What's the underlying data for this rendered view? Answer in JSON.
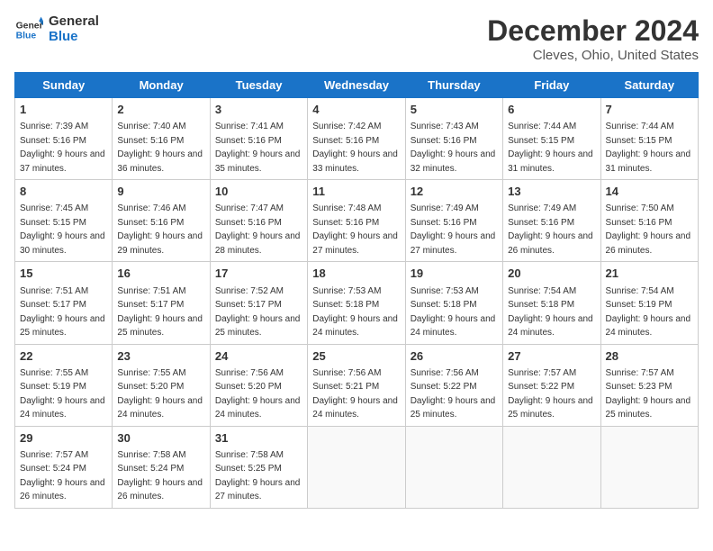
{
  "header": {
    "logo_line1": "General",
    "logo_line2": "Blue",
    "title": "December 2024",
    "subtitle": "Cleves, Ohio, United States"
  },
  "days_of_week": [
    "Sunday",
    "Monday",
    "Tuesday",
    "Wednesday",
    "Thursday",
    "Friday",
    "Saturday"
  ],
  "weeks": [
    [
      {
        "day": "1",
        "sunrise": "7:39 AM",
        "sunset": "5:16 PM",
        "daylight": "9 hours and 37 minutes."
      },
      {
        "day": "2",
        "sunrise": "7:40 AM",
        "sunset": "5:16 PM",
        "daylight": "9 hours and 36 minutes."
      },
      {
        "day": "3",
        "sunrise": "7:41 AM",
        "sunset": "5:16 PM",
        "daylight": "9 hours and 35 minutes."
      },
      {
        "day": "4",
        "sunrise": "7:42 AM",
        "sunset": "5:16 PM",
        "daylight": "9 hours and 33 minutes."
      },
      {
        "day": "5",
        "sunrise": "7:43 AM",
        "sunset": "5:16 PM",
        "daylight": "9 hours and 32 minutes."
      },
      {
        "day": "6",
        "sunrise": "7:44 AM",
        "sunset": "5:15 PM",
        "daylight": "9 hours and 31 minutes."
      },
      {
        "day": "7",
        "sunrise": "7:44 AM",
        "sunset": "5:15 PM",
        "daylight": "9 hours and 31 minutes."
      }
    ],
    [
      {
        "day": "8",
        "sunrise": "7:45 AM",
        "sunset": "5:15 PM",
        "daylight": "9 hours and 30 minutes."
      },
      {
        "day": "9",
        "sunrise": "7:46 AM",
        "sunset": "5:16 PM",
        "daylight": "9 hours and 29 minutes."
      },
      {
        "day": "10",
        "sunrise": "7:47 AM",
        "sunset": "5:16 PM",
        "daylight": "9 hours and 28 minutes."
      },
      {
        "day": "11",
        "sunrise": "7:48 AM",
        "sunset": "5:16 PM",
        "daylight": "9 hours and 27 minutes."
      },
      {
        "day": "12",
        "sunrise": "7:49 AM",
        "sunset": "5:16 PM",
        "daylight": "9 hours and 27 minutes."
      },
      {
        "day": "13",
        "sunrise": "7:49 AM",
        "sunset": "5:16 PM",
        "daylight": "9 hours and 26 minutes."
      },
      {
        "day": "14",
        "sunrise": "7:50 AM",
        "sunset": "5:16 PM",
        "daylight": "9 hours and 26 minutes."
      }
    ],
    [
      {
        "day": "15",
        "sunrise": "7:51 AM",
        "sunset": "5:17 PM",
        "daylight": "9 hours and 25 minutes."
      },
      {
        "day": "16",
        "sunrise": "7:51 AM",
        "sunset": "5:17 PM",
        "daylight": "9 hours and 25 minutes."
      },
      {
        "day": "17",
        "sunrise": "7:52 AM",
        "sunset": "5:17 PM",
        "daylight": "9 hours and 25 minutes."
      },
      {
        "day": "18",
        "sunrise": "7:53 AM",
        "sunset": "5:18 PM",
        "daylight": "9 hours and 24 minutes."
      },
      {
        "day": "19",
        "sunrise": "7:53 AM",
        "sunset": "5:18 PM",
        "daylight": "9 hours and 24 minutes."
      },
      {
        "day": "20",
        "sunrise": "7:54 AM",
        "sunset": "5:18 PM",
        "daylight": "9 hours and 24 minutes."
      },
      {
        "day": "21",
        "sunrise": "7:54 AM",
        "sunset": "5:19 PM",
        "daylight": "9 hours and 24 minutes."
      }
    ],
    [
      {
        "day": "22",
        "sunrise": "7:55 AM",
        "sunset": "5:19 PM",
        "daylight": "9 hours and 24 minutes."
      },
      {
        "day": "23",
        "sunrise": "7:55 AM",
        "sunset": "5:20 PM",
        "daylight": "9 hours and 24 minutes."
      },
      {
        "day": "24",
        "sunrise": "7:56 AM",
        "sunset": "5:20 PM",
        "daylight": "9 hours and 24 minutes."
      },
      {
        "day": "25",
        "sunrise": "7:56 AM",
        "sunset": "5:21 PM",
        "daylight": "9 hours and 24 minutes."
      },
      {
        "day": "26",
        "sunrise": "7:56 AM",
        "sunset": "5:22 PM",
        "daylight": "9 hours and 25 minutes."
      },
      {
        "day": "27",
        "sunrise": "7:57 AM",
        "sunset": "5:22 PM",
        "daylight": "9 hours and 25 minutes."
      },
      {
        "day": "28",
        "sunrise": "7:57 AM",
        "sunset": "5:23 PM",
        "daylight": "9 hours and 25 minutes."
      }
    ],
    [
      {
        "day": "29",
        "sunrise": "7:57 AM",
        "sunset": "5:24 PM",
        "daylight": "9 hours and 26 minutes."
      },
      {
        "day": "30",
        "sunrise": "7:58 AM",
        "sunset": "5:24 PM",
        "daylight": "9 hours and 26 minutes."
      },
      {
        "day": "31",
        "sunrise": "7:58 AM",
        "sunset": "5:25 PM",
        "daylight": "9 hours and 27 minutes."
      },
      null,
      null,
      null,
      null
    ]
  ]
}
